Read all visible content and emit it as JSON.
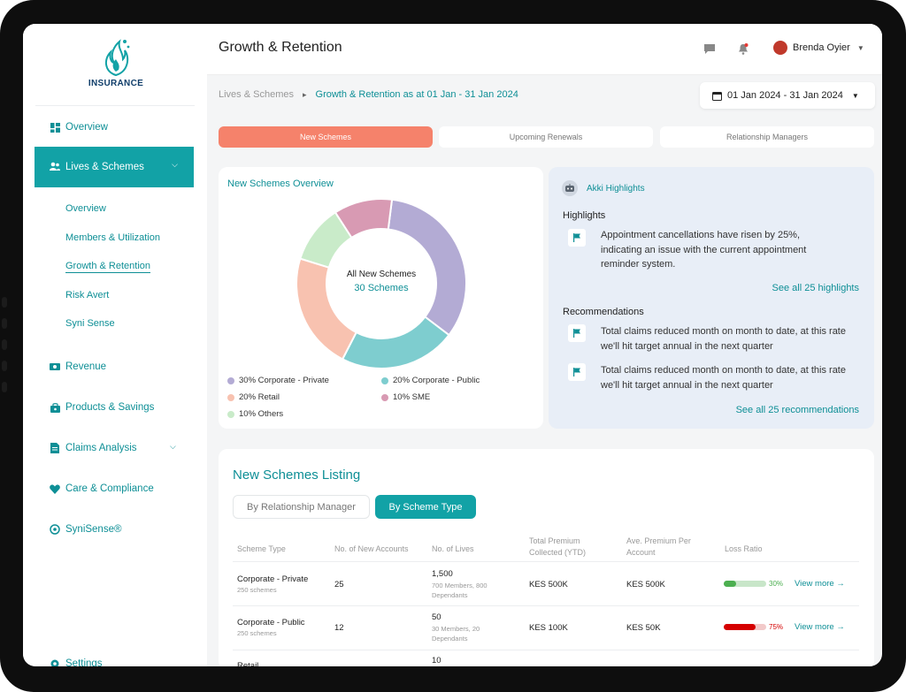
{
  "app": {
    "logo_text": "INSURANCE",
    "title": "Growth & Retention",
    "user_name": "Brenda Oyier"
  },
  "sidebar": {
    "items": [
      {
        "label": "Overview",
        "icon": "grid-icon"
      },
      {
        "label": "Lives & Schemes",
        "icon": "people-icon",
        "active": true
      },
      {
        "label": "Revenue",
        "icon": "cash-icon"
      },
      {
        "label": "Products & Savings",
        "icon": "bag-icon"
      },
      {
        "label": "Claims Analysis",
        "icon": "document-icon"
      },
      {
        "label": "Care & Compliance",
        "icon": "heart-icon"
      },
      {
        "label": "SyniSense®",
        "icon": "sparkle-icon"
      },
      {
        "label": "Settings",
        "icon": "gear-icon"
      }
    ],
    "sub_items": [
      "Overview",
      "Members & Utilization",
      "Growth & Retention",
      "Risk Avert",
      "Syni Sense"
    ]
  },
  "breadcrumb": {
    "parent": "Lives & Schemes",
    "current": "Growth & Retention as at 01 Jan  - 31 Jan 2024"
  },
  "date_range": "01 Jan 2024 - 31 Jan 2024",
  "tabs": [
    "New Schemes",
    "Upcoming Renewals",
    "Relationship Managers"
  ],
  "overview": {
    "title": "New Schemes Overview",
    "center_label": "All New Schemes",
    "center_value": "30 Schemes"
  },
  "chart_data": {
    "type": "pie",
    "donut": true,
    "slices": [
      {
        "label": "30% Corporate - Private",
        "value": 30,
        "color": "#b3abd4"
      },
      {
        "label": "20% Corporate - Public",
        "value": 20,
        "color": "#7ecdcf"
      },
      {
        "label": "20% Retail",
        "value": 20,
        "color": "#f8c2b0"
      },
      {
        "label": "10% Others",
        "value": 10,
        "color": "#c9ebc9"
      },
      {
        "label": "10% SME",
        "value": 10,
        "color": "#d89ab3"
      }
    ]
  },
  "highlights": {
    "header": "Akki Highlights",
    "section_highlights": "Highlights",
    "highlight_text": "Appointment cancellations have risen by 25%, indicating an issue with the current appointment reminder system.",
    "see_all_highlights": "See all 25 highlights",
    "section_recommendations": "Recommendations",
    "recommendations": [
      "Total claims reduced month on month to date, at this rate we'll hit target annual  in the next quarter",
      "Total claims reduced month on month to date, at this rate we'll hit target annual  in the next quarter"
    ],
    "see_all_recommendations": "See all 25 recommendations"
  },
  "listing": {
    "title": "New Schemes Listing",
    "toggle": [
      "By Relationship Manager",
      "By Scheme Type"
    ],
    "columns": [
      "Scheme Type",
      "No. of New Accounts",
      "No. of Lives",
      "Total Premium Collected (YTD)",
      "Ave. Premium Per Account",
      "Loss Ratio"
    ],
    "view_more": "View more →",
    "rows": [
      {
        "type": "Corporate - Private",
        "schemes": "250 schemes",
        "accounts": "25",
        "lives": "1,500",
        "lives_detail": "700 Members, 800 Dependants",
        "premium": "KES 500K",
        "average": "KES 500K",
        "loss_ratio": 30,
        "loss_label": "30%"
      },
      {
        "type": "Corporate - Public",
        "schemes": "250 schemes",
        "accounts": "12",
        "lives": "50",
        "lives_detail": "30 Members, 20 Dependants",
        "premium": "KES 100K",
        "average": "KES 50K",
        "loss_ratio": 75,
        "loss_label": "75%"
      },
      {
        "type": "Retail",
        "lives": "10"
      }
    ]
  },
  "colors": {
    "accent": "#12a2a6",
    "tab_active": "#f5826b",
    "loss_good": "#4caf50",
    "loss_bad": "#d50000"
  }
}
